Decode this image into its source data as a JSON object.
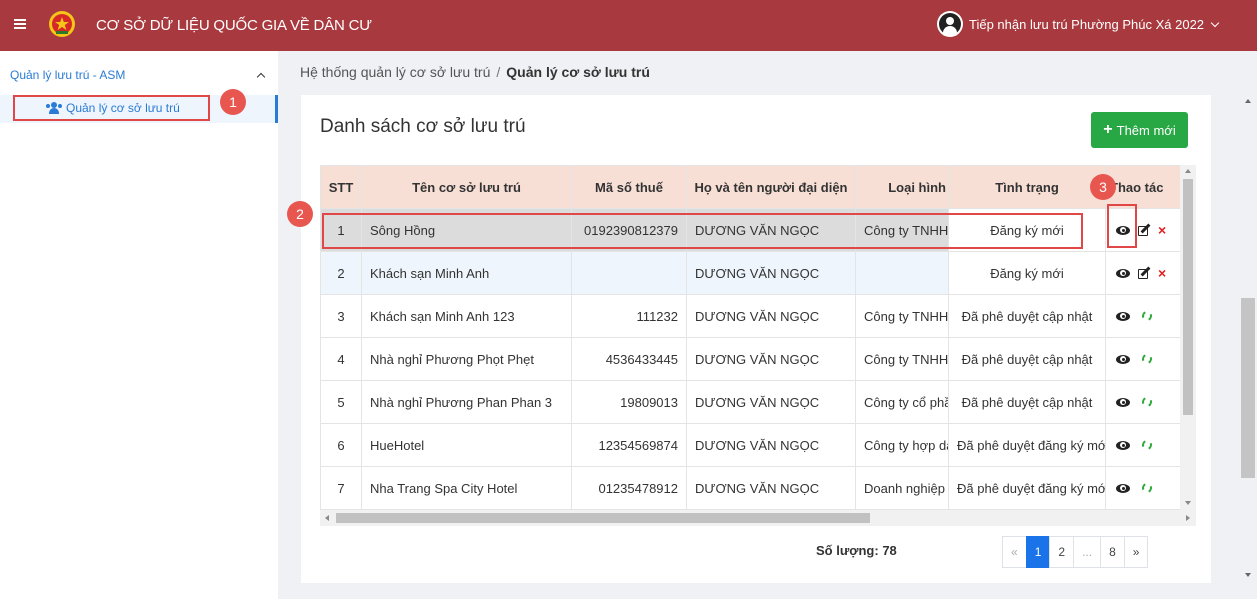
{
  "header": {
    "app_title": "CƠ SỞ DỮ LIỆU QUỐC GIA VỀ DÂN CƯ",
    "user_name": "Tiếp nhận lưu trú Phường Phúc Xá 2022",
    "bar_color": "#a83a3f"
  },
  "sidebar": {
    "group_label": "Quản lý lưu trú - ASM",
    "item_label": "Quản lý cơ sở lưu trú"
  },
  "breadcrumb": {
    "root": "Hệ thống quản lý cơ sở lưu trú",
    "separator": "/",
    "current": "Quản lý cơ sở lưu trú"
  },
  "main": {
    "title": "Danh sách cơ sở lưu trú",
    "add_label": "Thêm mới",
    "columns": [
      "STT",
      "Tên cơ sở lưu trú",
      "Mã số thuế",
      "Họ và tên người đại diện",
      "Loại hình",
      "Tình trạng",
      "Thao tác"
    ],
    "rows": [
      {
        "stt": "1",
        "name": "Sông Hồng",
        "tax": "0192390812379",
        "rep": "DƯƠNG VĂN NGỌC",
        "type": "Công ty TNHH",
        "status": "Đăng ký mới",
        "actions": "view-edit-delete"
      },
      {
        "stt": "2",
        "name": "Khách sạn Minh Anh",
        "tax": "",
        "rep": "DƯƠNG VĂN NGỌC",
        "type": "",
        "status": "Đăng ký mới",
        "actions": "view-edit-delete"
      },
      {
        "stt": "3",
        "name": "Khách sạn Minh Anh 123",
        "tax": "111232",
        "rep": "DƯƠNG VĂN NGỌC",
        "type": "Công ty TNHH",
        "status": "Đã phê duyệt cập nhật",
        "actions": "view-refresh"
      },
      {
        "stt": "4",
        "name": "Nhà nghỉ Phương Phọt Phẹt",
        "tax": "4536433445",
        "rep": "DƯƠNG VĂN NGỌC",
        "type": "Công ty TNHH",
        "status": "Đã phê duyệt cập nhật",
        "actions": "view-refresh"
      },
      {
        "stt": "5",
        "name": "Nhà nghỉ Phương Phan Phan 3",
        "tax": "19809013",
        "rep": "DƯƠNG VĂN NGỌC",
        "type": "Công ty cổ phần",
        "status": "Đã phê duyệt cập nhật",
        "actions": "view-refresh"
      },
      {
        "stt": "6",
        "name": "HueHotel",
        "tax": "12354569874",
        "rep": "DƯƠNG VĂN NGỌC",
        "type": "Công ty hợp danh",
        "status": "Đã phê duyệt đăng ký mới",
        "actions": "view-refresh"
      },
      {
        "stt": "7",
        "name": "Nha Trang Spa City Hotel",
        "tax": "01235478912",
        "rep": "DƯƠNG VĂN NGỌC",
        "type": "Doanh nghiệp",
        "status": "Đã phê duyệt đăng ký mới",
        "actions": "view-refresh"
      }
    ],
    "count_label": "Số lượng: 78",
    "pagination": [
      "«",
      "1",
      "2",
      "...",
      "8",
      "»"
    ],
    "active_page": "1"
  },
  "annotations": {
    "badge1": "1",
    "badge2": "2",
    "badge3": "3",
    "color": "#e04848"
  }
}
